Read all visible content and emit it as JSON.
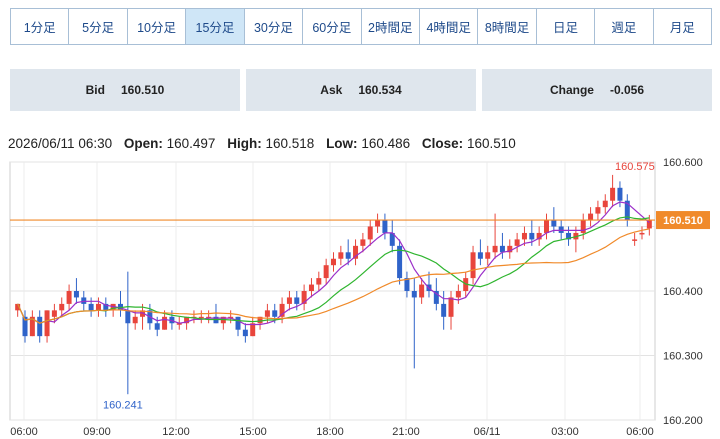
{
  "timeframes": [
    "1分足",
    "5分足",
    "10分足",
    "15分足",
    "30分足",
    "60分足",
    "2時間足",
    "4時間足",
    "8時間足",
    "日足",
    "週足",
    "月足"
  ],
  "active_timeframe": "15分足",
  "quote": {
    "bid_label": "Bid",
    "bid_value": "160.510",
    "ask_label": "Ask",
    "ask_value": "160.534",
    "change_label": "Change",
    "change_value": "-0.056"
  },
  "ohlc": {
    "datetime": "2026/06/11 06:30",
    "open_label": "Open:",
    "open": "160.497",
    "high_label": "High:",
    "high": "160.518",
    "low_label": "Low:",
    "low": "160.486",
    "close_label": "Close:",
    "close": "160.510"
  },
  "colors": {
    "up": "#e8453c",
    "down": "#2f63c9",
    "ma_short": "#9b2fc9",
    "ma_mid": "#2fb52f",
    "ma_long": "#f08a2a",
    "ref_line": "#f08a2a",
    "price_tag": "#f08a2a"
  },
  "chart_data": {
    "type": "candlestick",
    "ylim": [
      160.2,
      160.6
    ],
    "y_ticks": [
      "160.600",
      "160.400",
      "160.300",
      "160.200"
    ],
    "x_ticks": [
      "06:00",
      "09:00",
      "12:00",
      "15:00",
      "18:00",
      "21:00",
      "06/11",
      "03:00",
      "06:00"
    ],
    "reference_line": 160.51,
    "current_price_label": "160.510",
    "max_label": "160.575",
    "min_label": "160.241",
    "candles": [
      [
        160.37,
        160.38,
        160.36,
        160.38
      ],
      [
        160.36,
        160.37,
        160.32,
        160.33
      ],
      [
        160.33,
        160.37,
        160.33,
        160.36
      ],
      [
        160.36,
        160.37,
        160.32,
        160.33
      ],
      [
        160.33,
        160.37,
        160.32,
        160.37
      ],
      [
        160.36,
        160.38,
        160.35,
        160.37
      ],
      [
        160.37,
        160.39,
        160.36,
        160.38
      ],
      [
        160.38,
        160.41,
        160.37,
        160.4
      ],
      [
        160.4,
        160.42,
        160.38,
        160.39
      ],
      [
        160.39,
        160.4,
        160.37,
        160.38
      ],
      [
        160.38,
        160.39,
        160.36,
        160.37
      ],
      [
        160.37,
        160.39,
        160.36,
        160.38
      ],
      [
        160.38,
        160.39,
        160.36,
        160.37
      ],
      [
        160.37,
        160.38,
        160.36,
        160.38
      ],
      [
        160.38,
        160.4,
        160.36,
        160.37
      ],
      [
        160.37,
        160.43,
        160.24,
        160.35
      ],
      [
        160.35,
        160.37,
        160.34,
        160.36
      ],
      [
        160.36,
        160.38,
        160.34,
        160.37
      ],
      [
        160.37,
        160.38,
        160.34,
        160.35
      ],
      [
        160.35,
        160.36,
        160.33,
        160.34
      ],
      [
        160.34,
        160.37,
        160.34,
        160.36
      ],
      [
        160.36,
        160.37,
        160.34,
        160.35
      ],
      [
        160.35,
        160.36,
        160.34,
        160.35
      ],
      [
        160.35,
        160.36,
        160.34,
        160.36
      ],
      [
        160.36,
        160.37,
        160.35,
        160.36
      ],
      [
        160.36,
        160.37,
        160.35,
        160.36
      ],
      [
        160.36,
        160.37,
        160.35,
        160.36
      ],
      [
        160.36,
        160.38,
        160.35,
        160.35
      ],
      [
        160.35,
        160.36,
        160.34,
        160.36
      ],
      [
        160.36,
        160.37,
        160.35,
        160.36
      ],
      [
        160.36,
        160.36,
        160.33,
        160.34
      ],
      [
        160.34,
        160.35,
        160.32,
        160.33
      ],
      [
        160.33,
        160.36,
        160.33,
        160.35
      ],
      [
        160.35,
        160.36,
        160.34,
        160.36
      ],
      [
        160.36,
        160.38,
        160.35,
        160.37
      ],
      [
        160.37,
        160.38,
        160.35,
        160.36
      ],
      [
        160.36,
        160.39,
        160.35,
        160.38
      ],
      [
        160.38,
        160.4,
        160.37,
        160.39
      ],
      [
        160.39,
        160.4,
        160.37,
        160.38
      ],
      [
        160.38,
        160.41,
        160.37,
        160.4
      ],
      [
        160.4,
        160.42,
        160.39,
        160.41
      ],
      [
        160.41,
        160.43,
        160.4,
        160.42
      ],
      [
        160.42,
        160.45,
        160.41,
        160.44
      ],
      [
        160.44,
        160.46,
        160.43,
        160.45
      ],
      [
        160.45,
        160.47,
        160.44,
        160.46
      ],
      [
        160.46,
        160.48,
        160.44,
        160.45
      ],
      [
        160.45,
        160.48,
        160.44,
        160.47
      ],
      [
        160.47,
        160.49,
        160.46,
        160.48
      ],
      [
        160.48,
        160.51,
        160.47,
        160.5
      ],
      [
        160.5,
        160.52,
        160.49,
        160.51
      ],
      [
        160.51,
        160.52,
        160.48,
        160.49
      ],
      [
        160.49,
        160.51,
        160.46,
        160.47
      ],
      [
        160.47,
        160.48,
        160.41,
        160.42
      ],
      [
        160.42,
        160.43,
        160.39,
        160.4
      ],
      [
        160.4,
        160.42,
        160.28,
        160.39
      ],
      [
        160.39,
        160.42,
        160.38,
        160.41
      ],
      [
        160.41,
        160.43,
        160.39,
        160.4
      ],
      [
        160.4,
        160.42,
        160.37,
        160.38
      ],
      [
        160.38,
        160.4,
        160.34,
        160.36
      ],
      [
        160.36,
        160.4,
        160.34,
        160.39
      ],
      [
        160.39,
        160.41,
        160.38,
        160.4
      ],
      [
        160.4,
        160.43,
        160.39,
        160.42
      ],
      [
        160.42,
        160.47,
        160.41,
        160.46
      ],
      [
        160.46,
        160.48,
        160.44,
        160.45
      ],
      [
        160.45,
        160.47,
        160.44,
        160.46
      ],
      [
        160.46,
        160.52,
        160.45,
        160.47
      ],
      [
        160.47,
        160.49,
        160.45,
        160.46
      ],
      [
        160.46,
        160.48,
        160.45,
        160.47
      ],
      [
        160.47,
        160.49,
        160.46,
        160.48
      ],
      [
        160.48,
        160.5,
        160.47,
        160.49
      ],
      [
        160.49,
        160.51,
        160.47,
        160.48
      ],
      [
        160.48,
        160.5,
        160.47,
        160.49
      ],
      [
        160.49,
        160.52,
        160.48,
        160.51
      ],
      [
        160.51,
        160.53,
        160.49,
        160.5
      ],
      [
        160.5,
        160.51,
        160.48,
        160.49
      ],
      [
        160.49,
        160.5,
        160.47,
        160.48
      ],
      [
        160.48,
        160.5,
        160.46,
        160.49
      ],
      [
        160.49,
        160.52,
        160.48,
        160.51
      ],
      [
        160.51,
        160.53,
        160.5,
        160.52
      ],
      [
        160.52,
        160.54,
        160.51,
        160.53
      ],
      [
        160.53,
        160.55,
        160.52,
        160.54
      ],
      [
        160.54,
        160.58,
        160.53,
        160.56
      ],
      [
        160.56,
        160.57,
        160.53,
        160.54
      ],
      [
        160.54,
        160.55,
        160.5,
        160.51
      ],
      [
        160.48,
        160.49,
        160.47,
        160.48
      ],
      [
        160.49,
        160.5,
        160.48,
        160.49
      ],
      [
        160.497,
        160.518,
        160.486,
        160.51
      ]
    ]
  }
}
